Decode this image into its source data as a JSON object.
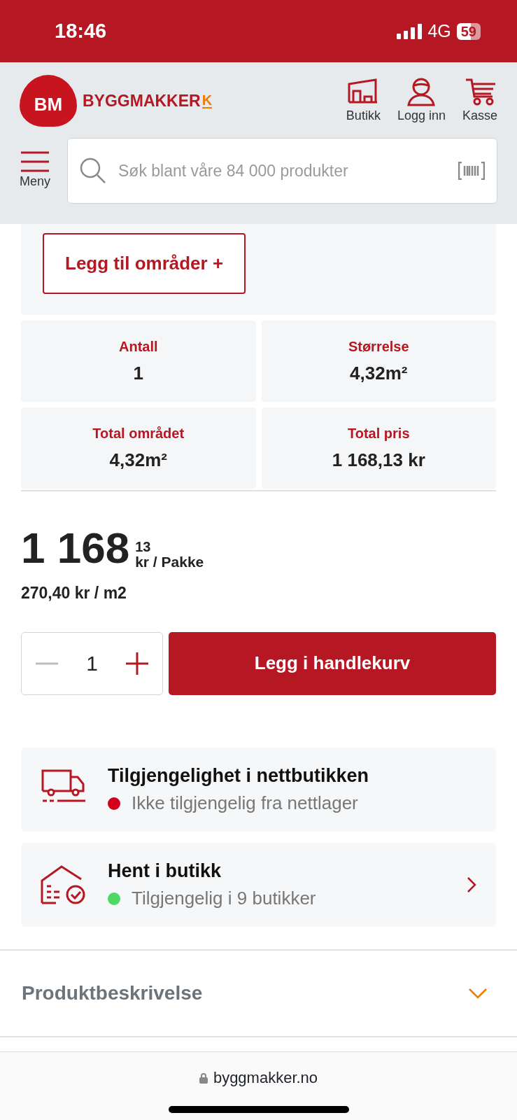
{
  "status_bar": {
    "time": "18:46",
    "network": "4G",
    "battery": "59"
  },
  "header": {
    "logo": {
      "badge": "BM",
      "name": "BYGGMAKKER",
      "mark": "K"
    },
    "actions": [
      {
        "kind": "store",
        "label": "Butikk"
      },
      {
        "kind": "user",
        "label": "Logg inn"
      },
      {
        "kind": "cart",
        "label": "Kasse"
      }
    ],
    "menu": {
      "label": "Meny"
    },
    "search": {
      "placeholder": "Søk blant våre 84 000 produkter"
    }
  },
  "add_area_button": "Legg til områder +",
  "stats": [
    {
      "label": "Antall",
      "value": "1"
    },
    {
      "label": "Størrelse",
      "value": "4,32m²"
    },
    {
      "label": "Total området",
      "value": "4,32m²"
    },
    {
      "label": "Total pris",
      "value": "1 168,13 kr"
    }
  ],
  "price": {
    "main": "1 168",
    "decimals": "13",
    "unit": "kr / Pakke",
    "per_unit": "270,40 kr / m2"
  },
  "quantity": {
    "value": "1",
    "decrease_disabled": true
  },
  "add_to_cart": "Legg i handlekurv",
  "availability": [
    {
      "kind": "delivery",
      "title": "Tilgjengelighet i nettbutikken",
      "status": "Ikke tilgjengelig fra nettlager",
      "color": "#d0021b",
      "link": false
    },
    {
      "kind": "pickup",
      "title": "Hent i butikk",
      "status": "Tilgjengelig i 9 butikker",
      "color": "#4cd964",
      "link": true
    }
  ],
  "accordion": {
    "title": "Produktbeskrivelse",
    "expanded": false
  },
  "browser": {
    "url": "byggmakker.no"
  }
}
